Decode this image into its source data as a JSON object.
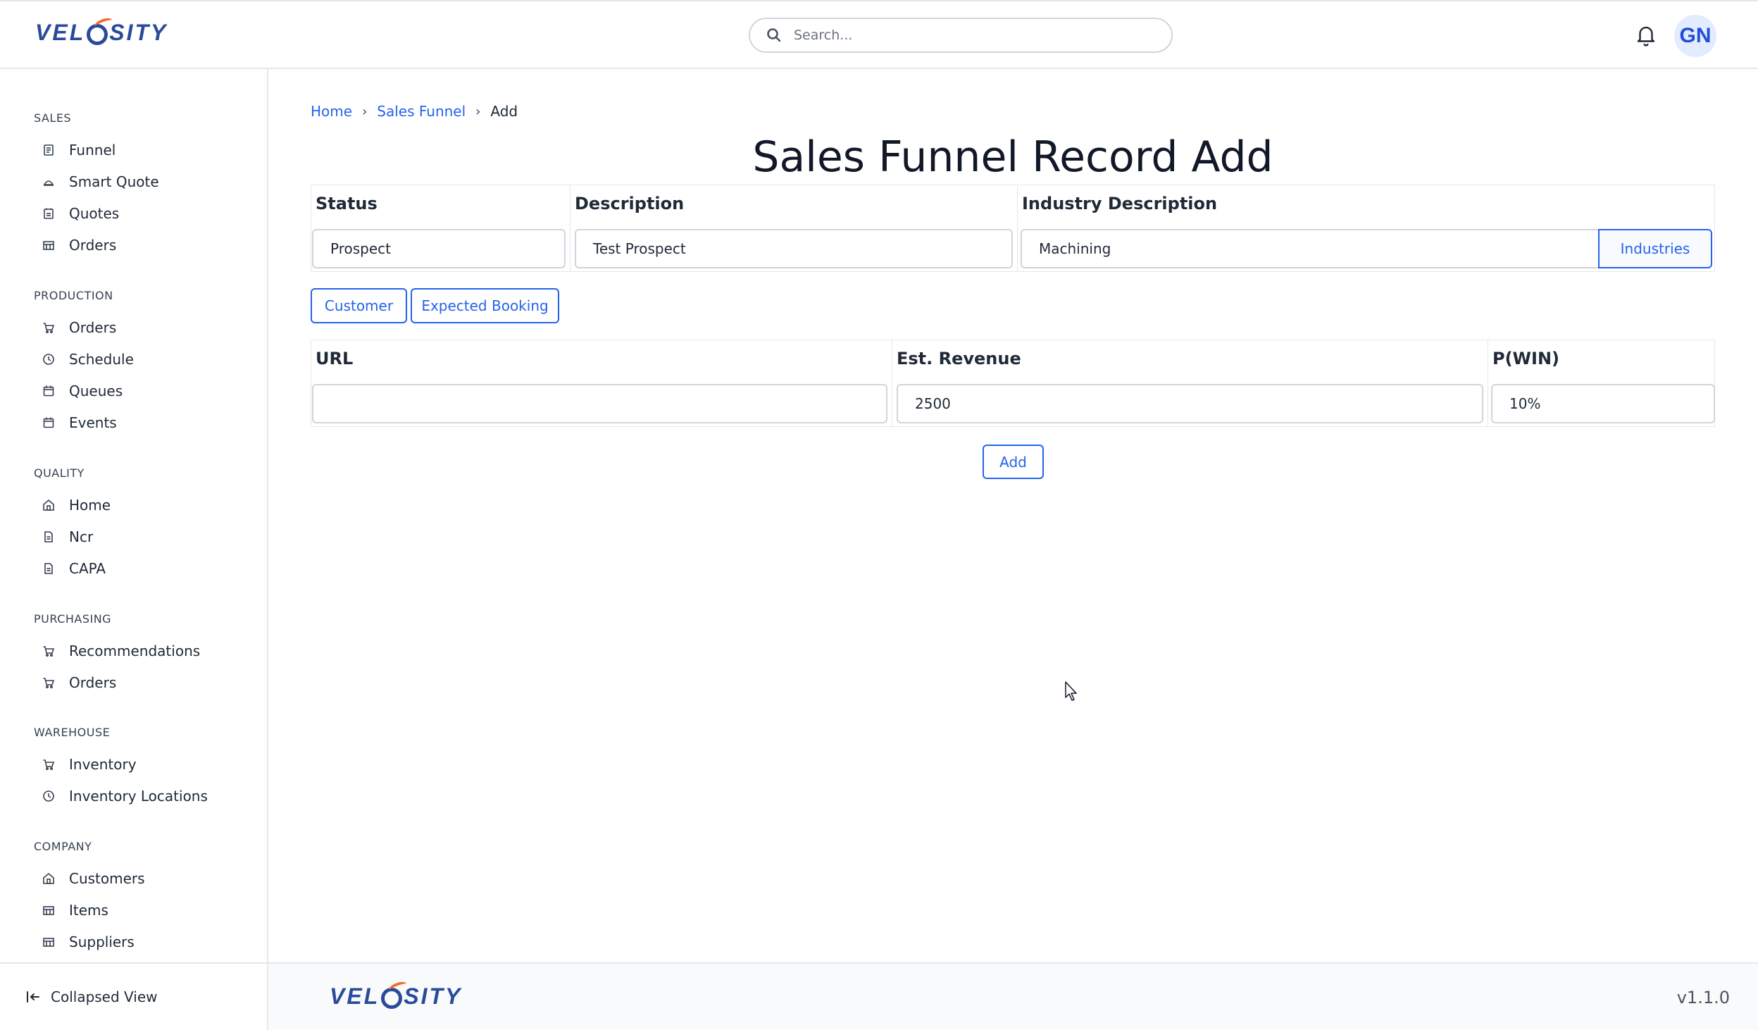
{
  "app": {
    "logo_text_left": "VEL",
    "logo_text_right": "SITY"
  },
  "header": {
    "search_placeholder": "Search...",
    "avatar_initials": "GN"
  },
  "sidebar": {
    "sections": [
      {
        "title": "SALES",
        "items": [
          {
            "label": "Funnel",
            "icon": "funnel-icon"
          },
          {
            "label": "Smart Quote",
            "icon": "smart-quote-icon"
          },
          {
            "label": "Quotes",
            "icon": "quotes-icon"
          },
          {
            "label": "Orders",
            "icon": "building-icon"
          }
        ]
      },
      {
        "title": "PRODUCTION",
        "items": [
          {
            "label": "Orders",
            "icon": "cart-icon"
          },
          {
            "label": "Schedule",
            "icon": "clock-icon"
          },
          {
            "label": "Queues",
            "icon": "calendar-icon"
          },
          {
            "label": "Events",
            "icon": "calendar-icon"
          }
        ]
      },
      {
        "title": "QUALITY",
        "items": [
          {
            "label": "Home",
            "icon": "home-icon"
          },
          {
            "label": "Ncr",
            "icon": "document-icon"
          },
          {
            "label": "CAPA",
            "icon": "document-icon"
          }
        ]
      },
      {
        "title": "PURCHASING",
        "items": [
          {
            "label": "Recommendations",
            "icon": "cart-icon"
          },
          {
            "label": "Orders",
            "icon": "cart-icon"
          }
        ]
      },
      {
        "title": "WAREHOUSE",
        "items": [
          {
            "label": "Inventory",
            "icon": "cart-icon"
          },
          {
            "label": "Inventory Locations",
            "icon": "clock-icon"
          }
        ]
      },
      {
        "title": "COMPANY",
        "items": [
          {
            "label": "Customers",
            "icon": "home-icon"
          },
          {
            "label": "Items",
            "icon": "building-icon"
          },
          {
            "label": "Suppliers",
            "icon": "building-icon"
          }
        ]
      }
    ],
    "collapse_label": "Collapsed View"
  },
  "breadcrumb": {
    "home": "Home",
    "sales_funnel": "Sales Funnel",
    "current": "Add"
  },
  "page": {
    "title": "Sales Funnel Record Add"
  },
  "form": {
    "status_label": "Status",
    "status_value": "Prospect",
    "description_label": "Description",
    "description_value": "Test Prospect",
    "industry_label": "Industry Description",
    "industry_value": "Machining",
    "industries_button": "Industries",
    "customer_button": "Customer",
    "expected_booking_button": "Expected Booking",
    "url_label": "URL",
    "url_value": "",
    "revenue_label": "Est. Revenue",
    "revenue_value": "2500",
    "pwin_label": "P(WIN)",
    "pwin_value": "10%",
    "add_button": "Add"
  },
  "footer": {
    "version": "v1.1.0"
  },
  "colors": {
    "accent": "#2563eb",
    "brand_blue": "#2a4a9a",
    "brand_orange": "#f26b2a"
  }
}
